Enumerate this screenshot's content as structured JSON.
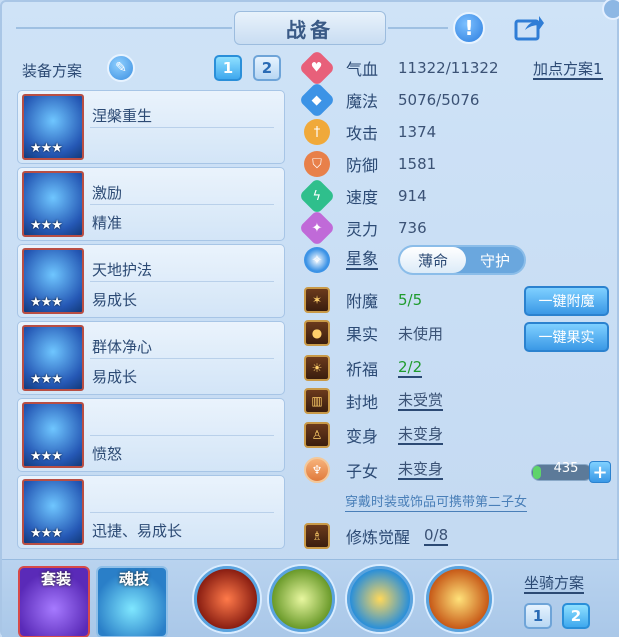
{
  "header": {
    "title": "战备"
  },
  "equip_plan": {
    "label": "装备方案",
    "buttons": [
      "1",
      "2"
    ],
    "active": "1"
  },
  "attr_plan": {
    "label": "加点方案1"
  },
  "equipment": [
    {
      "line1": "涅槃重生",
      "line2": "",
      "stars": "★★★"
    },
    {
      "line1": "激励",
      "line2": "精准",
      "stars": "★★★"
    },
    {
      "line1": "天地护法",
      "line2": "易成长",
      "stars": "★★★"
    },
    {
      "line1": "群体净心",
      "line2": "易成长",
      "stars": "★★★"
    },
    {
      "line1": "",
      "line2": "愤怒",
      "stars": "★★★"
    },
    {
      "line1": "",
      "line2": "迅捷、易成长",
      "stars": "★★★"
    }
  ],
  "stats": [
    {
      "name": "气血",
      "value": "11322/11322",
      "color": "#e8607a"
    },
    {
      "name": "魔法",
      "value": "5076/5076",
      "color": "#3c93e6"
    },
    {
      "name": "攻击",
      "value": "1374",
      "color": "#f0a93a"
    },
    {
      "name": "防御",
      "value": "1581",
      "color": "#e8804a"
    },
    {
      "name": "速度",
      "value": "914",
      "color": "#2fbf8c"
    },
    {
      "name": "灵力",
      "value": "736",
      "color": "#c06ad8"
    }
  ],
  "star_sign": {
    "label": "星象",
    "options": [
      "薄命",
      "守护"
    ],
    "active": "薄命"
  },
  "others": [
    {
      "name": "附魔",
      "value": "5/5",
      "style": "green"
    },
    {
      "name": "果实",
      "value": "未使用",
      "style": "plain"
    },
    {
      "name": "祈福",
      "value": "2/2",
      "style": "green-u"
    },
    {
      "name": "封地",
      "value": "未受赏",
      "style": "u"
    },
    {
      "name": "变身",
      "value": "未变身",
      "style": "u"
    },
    {
      "name": "子女",
      "value": "未变身",
      "style": "u"
    }
  ],
  "actions": {
    "enchant": "一键附魔",
    "fruit": "一键果实"
  },
  "child_points": {
    "value": "435",
    "plus": "+"
  },
  "hint": "穿戴时装或饰品可携带第二子女",
  "cultivation": {
    "name": "修炼觉醒",
    "value": "0/8"
  },
  "bottom": {
    "suit_label": "套装",
    "soul_label": "魂技",
    "mount_plan_label": "坐骑方案",
    "mount_buttons": [
      "1",
      "2"
    ]
  }
}
